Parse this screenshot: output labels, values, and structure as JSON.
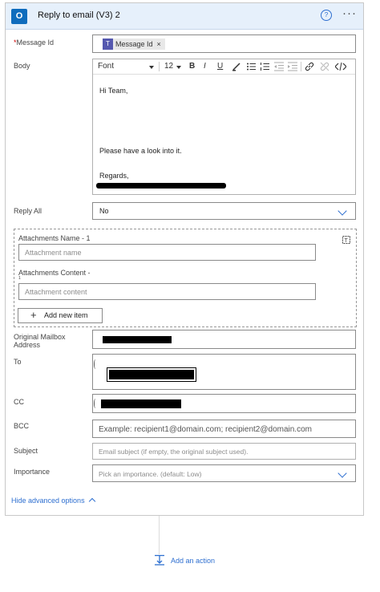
{
  "header": {
    "title": "Reply to email (V3) 2",
    "app_icon_text": "O",
    "help_glyph": "?",
    "more_glyph": "···"
  },
  "fields": {
    "message_id": {
      "label": "Message Id",
      "required_mark": "*",
      "token_label": "Message Id",
      "token_remove": "×",
      "token_icon": "T"
    },
    "body": {
      "label": "Body",
      "toolbar": {
        "font": "Font",
        "size": "12",
        "bold": "B",
        "italic": "I",
        "underline": "U"
      },
      "lines": [
        "Hi Team,",
        "Please have a look into it.",
        "Regards,"
      ]
    },
    "reply_all": {
      "label": "Reply All",
      "value": "No"
    },
    "attachments": {
      "name_label": "Attachments Name - 1",
      "name_placeholder": "Attachment name",
      "content_label": "Attachments Content -",
      "content_label_cont": "1",
      "content_placeholder": "Attachment content",
      "add_item_label": "Add new item",
      "add_item_glyph": "+"
    },
    "original_mailbox": {
      "label": "Original Mailbox",
      "label_line2": "Address"
    },
    "to": {
      "label": "To"
    },
    "cc": {
      "label": "CC"
    },
    "bcc": {
      "label": "BCC",
      "placeholder": "Example: recipient1@domain.com; recipient2@domain.com"
    },
    "subject": {
      "label": "Subject",
      "placeholder": "Email subject (if empty, the original subject used)."
    },
    "importance": {
      "label": "Importance",
      "placeholder": "Pick an importance. (default: Low)"
    }
  },
  "hide_advanced": "Hide advanced options",
  "add_action": "Add an action",
  "colors": {
    "accent": "#2e6fd0",
    "header_bg": "#e6f0fb",
    "outlook_blue": "#0f6cbd",
    "teams_purple": "#5558af"
  }
}
